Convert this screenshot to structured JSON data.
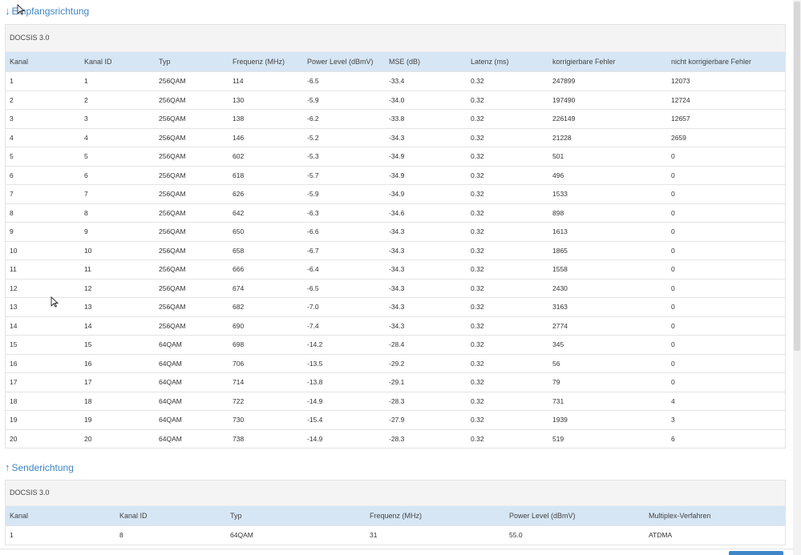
{
  "downstream": {
    "arrow": "↓",
    "title": "Empfangsrichtung",
    "docsis": "DOCSIS 3.0",
    "columns": [
      "Kanal",
      "Kanal ID",
      "Typ",
      "Frequenz (MHz)",
      "Power Level (dBmV)",
      "MSE (dB)",
      "Latenz (ms)",
      "korrigierbare Fehler",
      "nicht korrigierbare Fehler"
    ],
    "rows": [
      [
        "1",
        "1",
        "256QAM",
        "114",
        "-6.5",
        "-33.4",
        "0.32",
        "247899",
        "12073"
      ],
      [
        "2",
        "2",
        "256QAM",
        "130",
        "-5.9",
        "-34.0",
        "0.32",
        "197490",
        "12724"
      ],
      [
        "3",
        "3",
        "256QAM",
        "138",
        "-6.2",
        "-33.8",
        "0.32",
        "226149",
        "12657"
      ],
      [
        "4",
        "4",
        "256QAM",
        "146",
        "-5.2",
        "-34.3",
        "0.32",
        "21228",
        "2659"
      ],
      [
        "5",
        "5",
        "256QAM",
        "602",
        "-5.3",
        "-34.9",
        "0.32",
        "501",
        "0"
      ],
      [
        "6",
        "6",
        "256QAM",
        "618",
        "-5.7",
        "-34.9",
        "0.32",
        "496",
        "0"
      ],
      [
        "7",
        "7",
        "256QAM",
        "626",
        "-5.9",
        "-34.9",
        "0.32",
        "1533",
        "0"
      ],
      [
        "8",
        "8",
        "256QAM",
        "642",
        "-6.3",
        "-34.6",
        "0.32",
        "898",
        "0"
      ],
      [
        "9",
        "9",
        "256QAM",
        "650",
        "-6.6",
        "-34.3",
        "0.32",
        "1613",
        "0"
      ],
      [
        "10",
        "10",
        "256QAM",
        "658",
        "-6.7",
        "-34.3",
        "0.32",
        "1865",
        "0"
      ],
      [
        "11",
        "11",
        "256QAM",
        "666",
        "-6.4",
        "-34.3",
        "0.32",
        "1558",
        "0"
      ],
      [
        "12",
        "12",
        "256QAM",
        "674",
        "-6.5",
        "-34.3",
        "0.32",
        "2430",
        "0"
      ],
      [
        "13",
        "13",
        "256QAM",
        "682",
        "-7.0",
        "-34.3",
        "0.32",
        "3163",
        "0"
      ],
      [
        "14",
        "14",
        "256QAM",
        "690",
        "-7.4",
        "-34.3",
        "0.32",
        "2774",
        "0"
      ],
      [
        "15",
        "15",
        "64QAM",
        "698",
        "-14.2",
        "-28.4",
        "0.32",
        "345",
        "0"
      ],
      [
        "16",
        "16",
        "64QAM",
        "706",
        "-13.5",
        "-29.2",
        "0.32",
        "56",
        "0"
      ],
      [
        "17",
        "17",
        "64QAM",
        "714",
        "-13.8",
        "-29.1",
        "0.32",
        "79",
        "0"
      ],
      [
        "18",
        "18",
        "64QAM",
        "722",
        "-14.9",
        "-28.3",
        "0.32",
        "731",
        "4"
      ],
      [
        "19",
        "19",
        "64QAM",
        "730",
        "-15.4",
        "-27.9",
        "0.32",
        "1939",
        "3"
      ],
      [
        "20",
        "20",
        "64QAM",
        "738",
        "-14.9",
        "-28.3",
        "0.32",
        "519",
        "6"
      ]
    ]
  },
  "upstream": {
    "arrow": "↑",
    "title": "Senderichtung",
    "docsis": "DOCSIS 3.0",
    "columns": [
      "Kanal",
      "Kanal ID",
      "Typ",
      "Frequenz (MHz)",
      "Power Level (dBmV)",
      "Multiplex-Verfahren"
    ],
    "rows": [
      [
        "1",
        "8",
        "64QAM",
        "31",
        "55.0",
        "ATDMA"
      ]
    ]
  },
  "colors": {
    "accent": "#3f86c8",
    "header_row": "#d6e6f5",
    "panel_head": "#f4f4f4"
  }
}
